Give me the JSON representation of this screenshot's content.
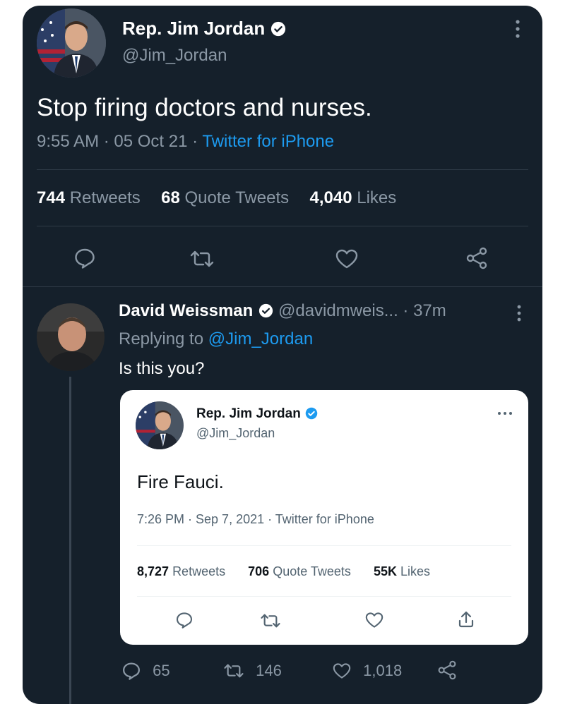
{
  "main_tweet": {
    "author_name": "Rep. Jim Jordan",
    "author_handle": "@Jim_Jordan",
    "text": "Stop firing doctors and nurses.",
    "timestamp": "9:55 AM · 05 Oct 21 · ",
    "source": "Twitter for iPhone",
    "retweets_count": "744",
    "retweets_label": "Retweets",
    "quotes_count": "68",
    "quotes_label": "Quote Tweets",
    "likes_count": "4,040",
    "likes_label": "Likes"
  },
  "reply": {
    "author_name": "David Weissman",
    "author_handle": "@davidmweis...",
    "time": "· 37m",
    "replying_prefix": "Replying to ",
    "replying_handle": "@Jim_Jordan",
    "text": "Is this you?",
    "reply_count": "65",
    "retweet_count": "146",
    "like_count": "1,018"
  },
  "quoted_tweet": {
    "author_name": "Rep. Jim Jordan",
    "author_handle": "@Jim_Jordan",
    "text": "Fire Fauci.",
    "timestamp": "7:26 PM · Sep 7, 2021 · Twitter for iPhone",
    "retweets_count": "8,727",
    "retweets_label": "Retweets",
    "quotes_count": "706",
    "quotes_label": "Quote Tweets",
    "likes_count": "55K",
    "likes_label": "Likes"
  },
  "colors": {
    "background": "#15202b",
    "accent_blue": "#1d9bf0",
    "secondary_text": "#8b98a5",
    "quoted_card": "#ffffff"
  }
}
